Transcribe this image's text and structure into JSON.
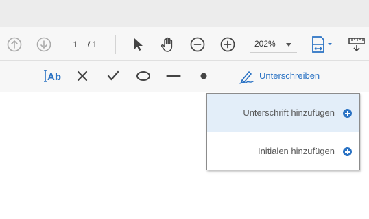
{
  "toolbar": {
    "page_current": "1",
    "page_separator": "/ 1",
    "zoom": "202%",
    "icons": [
      "arrow-up-icon",
      "arrow-down-icon",
      "select-arrow-icon",
      "hand-icon",
      "zoom-out-icon",
      "zoom-in-icon",
      "fit-page-icon",
      "measure-tool-icon"
    ]
  },
  "sign_toolbar": {
    "icons": [
      "text-ab-icon",
      "cross-mark-icon",
      "check-mark-icon",
      "ellipse-icon",
      "line-icon",
      "dot-icon",
      "sign-pen-icon"
    ],
    "sign_label": "Unterschreiben"
  },
  "dropdown": {
    "items": [
      {
        "label": "Unterschrift hinzufügen",
        "highlighted": true
      },
      {
        "label": "Initialen hinzufügen",
        "highlighted": false
      }
    ]
  },
  "colors": {
    "accent": "#2b73c4",
    "icon_gray": "#444444",
    "disabled_gray": "#aaaaaa",
    "highlight": "#e3eef9"
  }
}
